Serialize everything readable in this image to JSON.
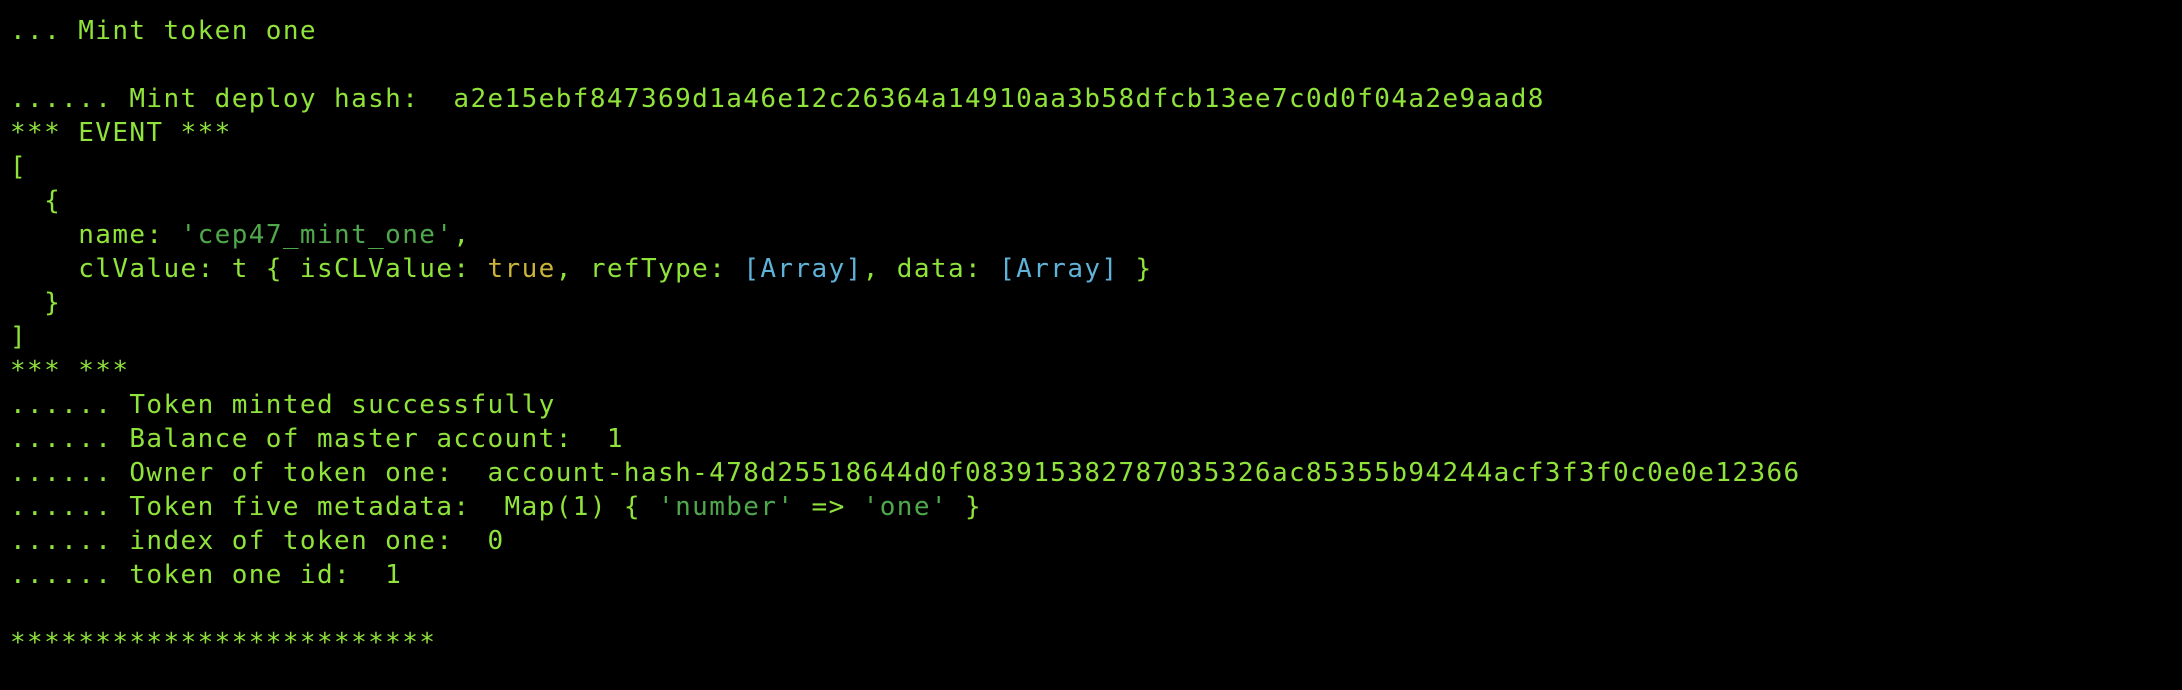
{
  "colors": {
    "background": "#000000",
    "text": "#8fe33a",
    "string": "#4fa84b",
    "boolean": "#c9b43a",
    "reference": "#5fb3d9"
  },
  "terminal": {
    "lines": {
      "l1": "... Mint token one",
      "l2a": "...... Mint deploy hash:  ",
      "l2b": "a2e15ebf847369d1a46e12c26364a14910aa3b58dfcb13ee7c0d0f04a2e9aad8",
      "l3": "*** EVENT ***",
      "l4": "[",
      "l5": "  {",
      "l6a": "    name: ",
      "l6b": "'cep47_mint_one'",
      "l6c": ",",
      "l7a": "    clValue: t { isCLValue: ",
      "l7b": "true",
      "l7c": ", refType: ",
      "l7d": "[Array]",
      "l7e": ", data: ",
      "l7f": "[Array]",
      "l7g": " }",
      "l8": "  }",
      "l9": "]",
      "l10": "*** ***",
      "l11": "...... Token minted successfully",
      "l12": "...... Balance of master account:  1",
      "l13": "...... Owner of token one:  account-hash-478d25518644d0f083915382787035326ac85355b94244acf3f3f0c0e0e12366",
      "l14a": "...... Token five metadata:  Map(1) { ",
      "l14b": "'number'",
      "l14c": " => ",
      "l14d": "'one'",
      "l14e": " }",
      "l15": "...... index of token one:  0",
      "l16": "...... token one id:  1",
      "l17": "*************************"
    }
  }
}
